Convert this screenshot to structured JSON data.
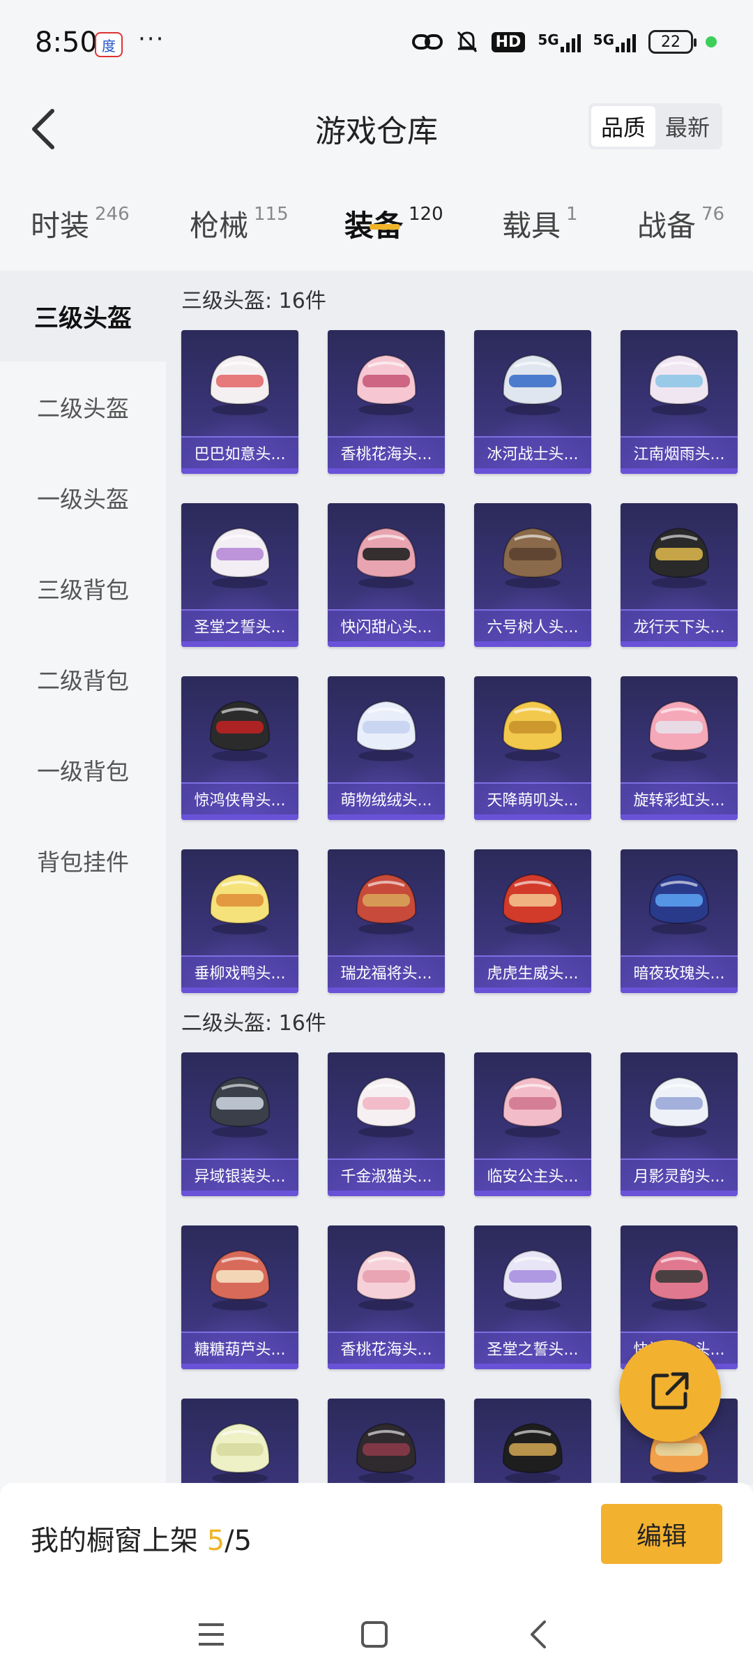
{
  "status_bar": {
    "time": "8:50",
    "app_icon_text": "度",
    "dots": "···",
    "hd_label": "HD",
    "net1": "5G",
    "net2": "5G",
    "battery": "22"
  },
  "header": {
    "title": "游戏仓库",
    "sort_quality": "品质",
    "sort_latest": "最新"
  },
  "tabs": [
    {
      "label": "时装",
      "count": "246"
    },
    {
      "label": "枪械",
      "count": "115"
    },
    {
      "label": "装备",
      "count": "120"
    },
    {
      "label": "载具",
      "count": "1"
    },
    {
      "label": "战备",
      "count": "76"
    }
  ],
  "sidebar": {
    "items": [
      "三级头盔",
      "二级头盔",
      "一级头盔",
      "三级背包",
      "二级背包",
      "一级背包",
      "背包挂件"
    ]
  },
  "sections": [
    {
      "title": "三级头盔: 16件",
      "items": [
        "巴巴如意头...",
        "香桃花海头...",
        "冰河战士头...",
        "江南烟雨头...",
        "圣堂之誓头...",
        "快闪甜心头...",
        "六号树人头...",
        "龙行天下头...",
        "惊鸿侠骨头...",
        "萌物绒绒头...",
        "天降萌叽头...",
        "旋转彩虹头...",
        "垂柳戏鸭头...",
        "瑞龙福将头...",
        "虎虎生威头...",
        "暗夜玫瑰头..."
      ]
    },
    {
      "title": "二级头盔: 16件",
      "items": [
        "异域银装头...",
        "千金淑猫头...",
        "临安公主头...",
        "月影灵韵头...",
        "糖糖葫芦头...",
        "香桃花海头...",
        "圣堂之誓头...",
        "快闪甜心头...",
        "",
        "",
        "",
        ""
      ]
    }
  ],
  "bottom": {
    "shelf_label": "我的橱窗上架",
    "shelf_current": "5",
    "shelf_total": "/5",
    "edit_label": "编辑"
  },
  "colors": {
    "accent": "#f2b12f",
    "card_bg": "#3a3478"
  }
}
